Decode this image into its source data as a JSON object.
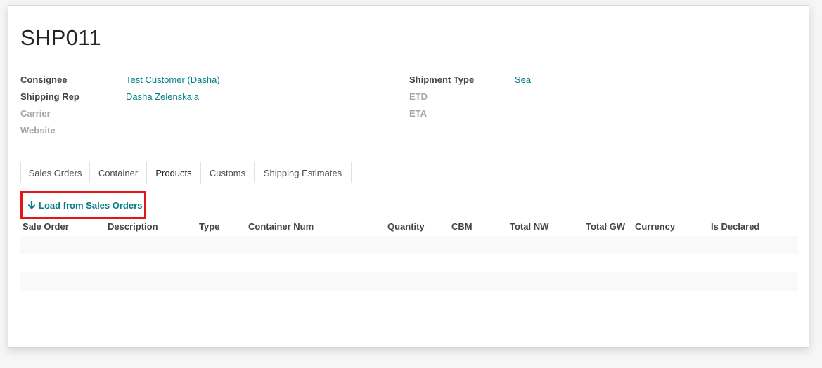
{
  "record": {
    "title": "SHP011"
  },
  "fields": {
    "left": [
      {
        "label": "Consignee",
        "value": "Test Customer (Dasha)",
        "muted": false
      },
      {
        "label": "Shipping Rep",
        "value": "Dasha Zelenskaia",
        "muted": false
      },
      {
        "label": "Carrier",
        "value": "",
        "muted": true
      },
      {
        "label": "Website",
        "value": "",
        "muted": true
      }
    ],
    "right": [
      {
        "label": "Shipment Type",
        "value": "Sea",
        "muted": false
      },
      {
        "label": "ETD",
        "value": "",
        "muted": true
      },
      {
        "label": "ETA",
        "value": "",
        "muted": true
      }
    ]
  },
  "tabs": [
    {
      "label": "Sales Orders",
      "active": false
    },
    {
      "label": "Container",
      "active": false
    },
    {
      "label": "Products",
      "active": true
    },
    {
      "label": "Customs",
      "active": false
    },
    {
      "label": "Shipping Estimates",
      "active": false
    }
  ],
  "actions": {
    "load_label": "Load from Sales Orders",
    "load_icon": "arrow-down-icon"
  },
  "table": {
    "columns": [
      "Sale Order",
      "Description",
      "Type",
      "Container Num",
      "Quantity",
      "CBM",
      "Total NW",
      "Total GW",
      "Currency",
      "Is Declared"
    ]
  },
  "colors": {
    "link": "#017e84",
    "highlight_border": "#e3151a",
    "active_tab_accent": "#7c4d70"
  }
}
